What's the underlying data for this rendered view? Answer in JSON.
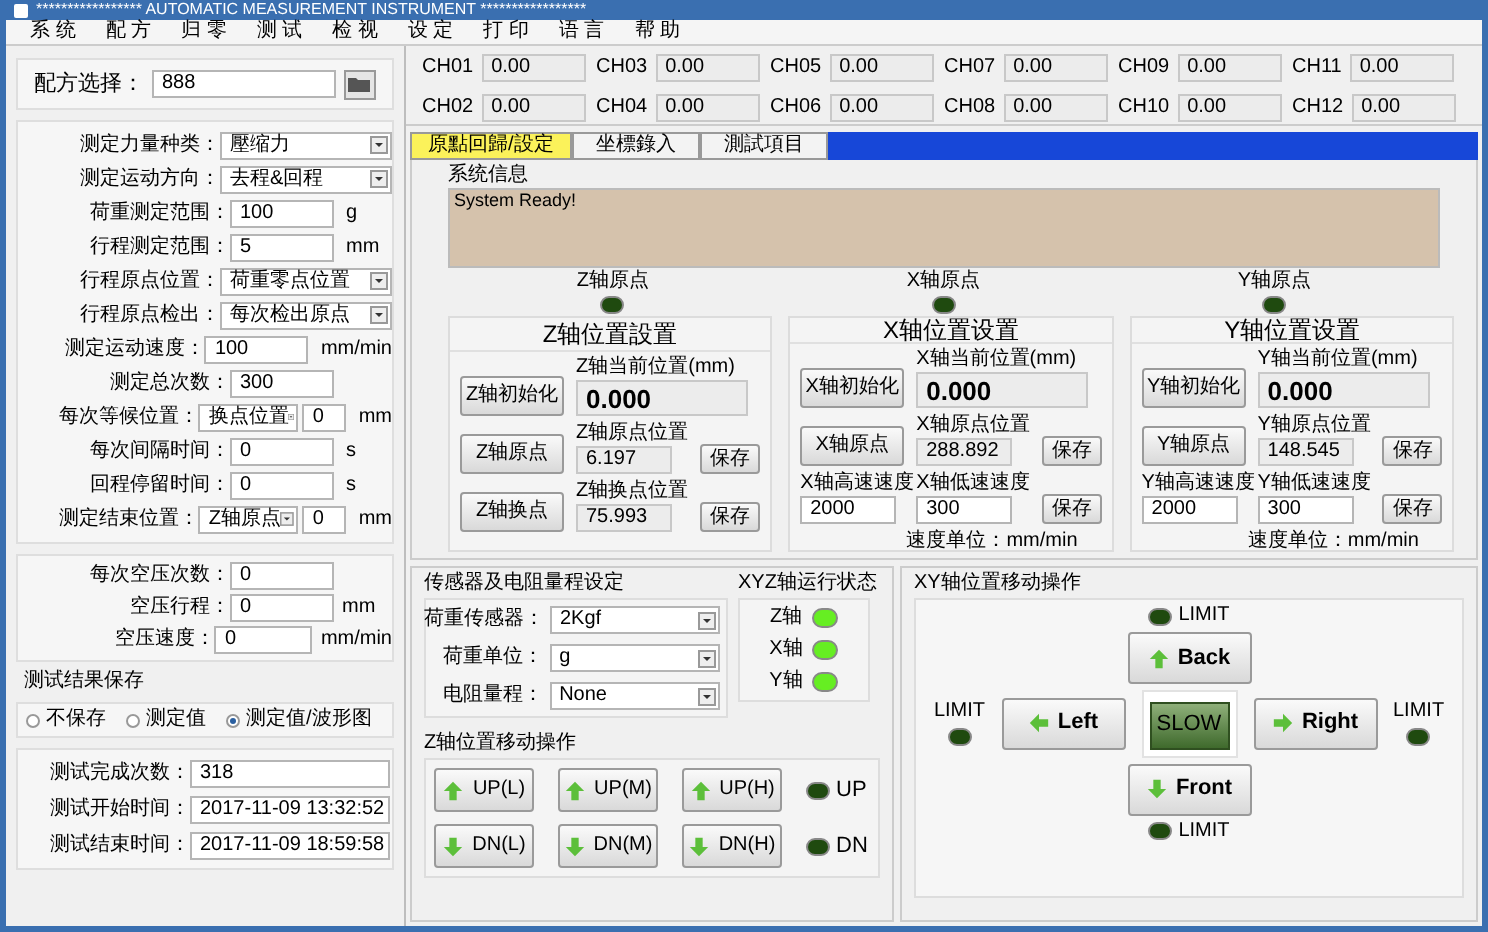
{
  "window": {
    "title": "***************** AUTOMATIC MEASUREMENT INSTRUMENT *****************"
  },
  "menu": [
    "系 统",
    "配 方",
    "归 零",
    "测 试",
    "检 视",
    "设 定",
    "打 印",
    "语 言",
    "帮 助"
  ],
  "recipe": {
    "label": "配方选择：",
    "value": "888"
  },
  "settings": [
    {
      "kind": "select",
      "label": "测定力量种类：",
      "value": "壓缩力"
    },
    {
      "kind": "select",
      "label": "测定运动方向：",
      "value": "去程&回程"
    },
    {
      "kind": "input",
      "label": "荷重测定范围：",
      "value": "100",
      "unit": "g"
    },
    {
      "kind": "input",
      "label": "行程测定范围：",
      "value": "5",
      "unit": "mm"
    },
    {
      "kind": "select",
      "label": "行程原点位置：",
      "value": "荷重零点位置"
    },
    {
      "kind": "select",
      "label": "行程原点检出：",
      "value": "每次检出原点"
    },
    {
      "kind": "input",
      "label": "测定运动速度：",
      "value": "100",
      "unit": "mm/min"
    },
    {
      "kind": "input",
      "label": "测定总次数：",
      "value": "300"
    },
    {
      "kind": "select_input",
      "label": "每次等候位置：",
      "value": "换点位置",
      "value2": "0",
      "unit": "mm"
    },
    {
      "kind": "input",
      "label": "每次间隔时间：",
      "value": "0",
      "unit": "s"
    },
    {
      "kind": "input",
      "label": "回程停留时间：",
      "value": "0",
      "unit": "s"
    },
    {
      "kind": "select_input",
      "label": "测定结束位置：",
      "value": "Z轴原点",
      "value2": "0",
      "unit": "mm"
    }
  ],
  "air_press": [
    {
      "label": "每次空压次数：",
      "value": "0"
    },
    {
      "label": "空压行程：",
      "value": "0",
      "unit": "mm"
    },
    {
      "label": "空压速度：",
      "value": "0",
      "unit": "mm/min"
    }
  ],
  "save_result": {
    "label": "测试结果保存",
    "options": [
      {
        "label": "不保存",
        "selected": false
      },
      {
        "label": "测定值",
        "selected": false
      },
      {
        "label": "测定值/波形图",
        "selected": true
      }
    ]
  },
  "results": [
    {
      "label": "测试完成次数：",
      "value": "318"
    },
    {
      "label": "测试开始时间：",
      "value": "2017-11-09 13:32:52"
    },
    {
      "label": "测试结束时间：",
      "value": "2017-11-09 18:59:58"
    }
  ],
  "channels": [
    {
      "label": "CH01",
      "value": "0.00"
    },
    {
      "label": "CH02",
      "value": "0.00"
    },
    {
      "label": "CH03",
      "value": "0.00"
    },
    {
      "label": "CH04",
      "value": "0.00"
    },
    {
      "label": "CH05",
      "value": "0.00"
    },
    {
      "label": "CH06",
      "value": "0.00"
    },
    {
      "label": "CH07",
      "value": "0.00"
    },
    {
      "label": "CH08",
      "value": "0.00"
    },
    {
      "label": "CH09",
      "value": "0.00"
    },
    {
      "label": "CH10",
      "value": "0.00"
    },
    {
      "label": "CH11",
      "value": "0.00"
    },
    {
      "label": "CH12",
      "value": "0.00"
    }
  ],
  "tabs": [
    {
      "label": "原點回歸/設定",
      "selected": true
    },
    {
      "label": "坐標錄入",
      "selected": false
    },
    {
      "label": "測試項目",
      "selected": false
    }
  ],
  "system_info": {
    "label": "系统信息",
    "text": "System Ready!"
  },
  "origins": [
    {
      "label": "Z轴原点",
      "on": false
    },
    {
      "label": "X轴原点",
      "on": false
    },
    {
      "label": "Y轴原点",
      "on": false
    }
  ],
  "axes": [
    {
      "title": "Z轴位置設置",
      "init_button": "Z轴初始化",
      "current_label": "Z轴当前位置(mm)",
      "current_value": "0.000",
      "rows": [
        {
          "kind": "button_row",
          "button": "Z轴原点",
          "label": "Z轴原点位置",
          "value": "6.197",
          "save": "保存"
        },
        {
          "kind": "button_row",
          "button": "Z轴换点",
          "label": "Z轴换点位置",
          "value": "75.993",
          "save": "保存"
        }
      ]
    },
    {
      "title": "X轴位置设置",
      "init_button": "X轴初始化",
      "current_label": "X轴当前位置(mm)",
      "current_value": "0.000",
      "note": "速度单位：mm/min",
      "rows": [
        {
          "kind": "button_row",
          "button": "X轴原点",
          "label": "X轴原点位置",
          "value": "288.892",
          "save": "保存"
        },
        {
          "kind": "speed_row",
          "label": "X轴高速速度",
          "value": "2000",
          "label2": "X轴低速速度",
          "value2": "300",
          "save": "保存"
        }
      ]
    },
    {
      "title": "Y轴位置设置",
      "init_button": "Y轴初始化",
      "current_label": "Y轴当前位置(mm)",
      "current_value": "0.000",
      "note": "速度单位：mm/min",
      "rows": [
        {
          "kind": "button_row",
          "button": "Y轴原点",
          "label": "Y轴原点位置",
          "value": "148.545",
          "save": "保存"
        },
        {
          "kind": "speed_row",
          "label": "Y轴高速速度",
          "value": "2000",
          "label2": "Y轴低速速度",
          "value2": "300",
          "save": "保存"
        }
      ]
    }
  ],
  "sensor": {
    "title": "传感器及电阻量程设定",
    "fields": [
      {
        "label": "荷重传感器：",
        "value": "2Kgf"
      },
      {
        "label": "荷重单位：",
        "value": "g"
      },
      {
        "label": "电阻量程：",
        "value": "None"
      }
    ]
  },
  "axis_status": {
    "title": "XYZ轴运行状态",
    "leds": [
      {
        "label": "Z轴",
        "on": true
      },
      {
        "label": "X轴",
        "on": true
      },
      {
        "label": "Y轴",
        "on": true
      }
    ]
  },
  "z_move": {
    "title": "Z轴位置移动操作",
    "rows": [
      {
        "kind": "up",
        "buttons": [
          "UP(L)",
          "UP(M)",
          "UP(H)"
        ],
        "indicator": {
          "label": "UP",
          "on": false
        }
      },
      {
        "kind": "down",
        "buttons": [
          "DN(L)",
          "DN(M)",
          "DN(H)"
        ],
        "indicator": {
          "label": "DN",
          "on": false
        }
      }
    ]
  },
  "xy_move": {
    "title": "XY轴位置移动操作",
    "limit_top": {
      "label": "LIMIT",
      "on": false
    },
    "limit_left": {
      "label": "LIMIT",
      "on": false
    },
    "limit_right": {
      "label": "LIMIT",
      "on": false
    },
    "limit_bottom": {
      "label": "LIMIT",
      "on": false
    },
    "back": {
      "label": "Back",
      "kind": "up"
    },
    "left": {
      "label": "Left",
      "kind": "left"
    },
    "right": {
      "label": "Right",
      "kind": "right"
    },
    "front": {
      "label": "Front",
      "kind": "down"
    },
    "slow": {
      "label": "SLOW",
      "on": true
    }
  }
}
